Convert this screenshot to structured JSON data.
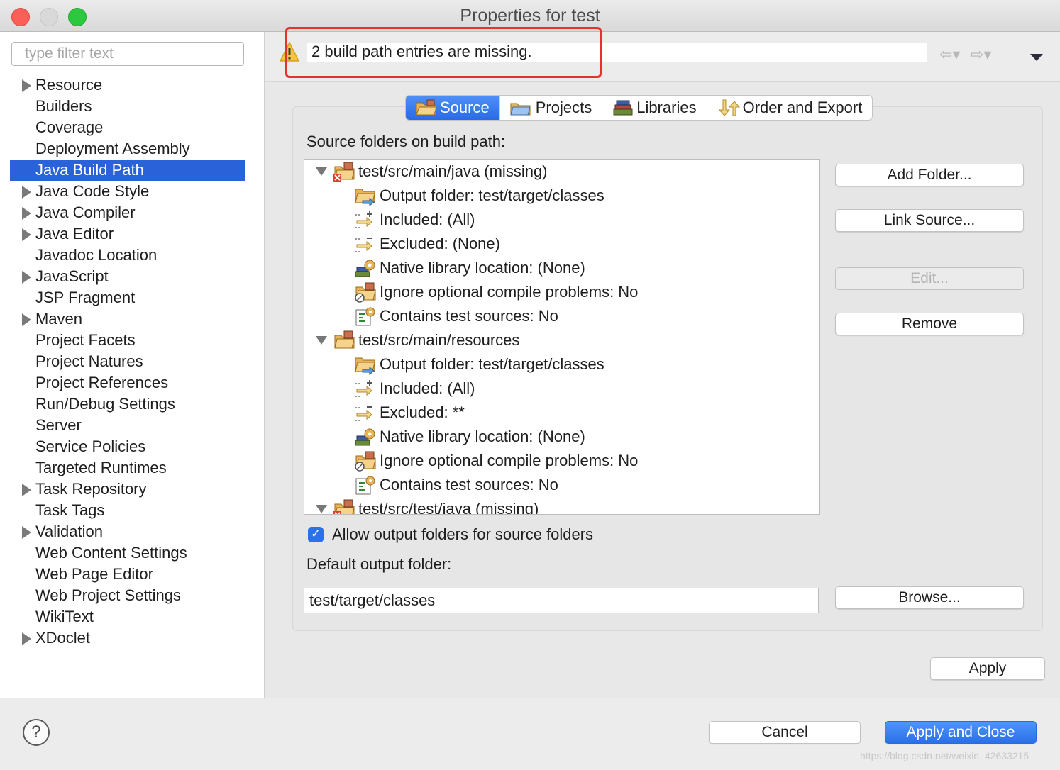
{
  "window": {
    "title": "Properties for test"
  },
  "sidebar": {
    "filter_placeholder": "type filter text",
    "items": [
      {
        "label": "Resource",
        "expandable": true
      },
      {
        "label": "Builders",
        "expandable": false
      },
      {
        "label": "Coverage",
        "expandable": false
      },
      {
        "label": "Deployment Assembly",
        "expandable": false
      },
      {
        "label": "Java Build Path",
        "expandable": false,
        "selected": true
      },
      {
        "label": "Java Code Style",
        "expandable": true
      },
      {
        "label": "Java Compiler",
        "expandable": true
      },
      {
        "label": "Java Editor",
        "expandable": true
      },
      {
        "label": "Javadoc Location",
        "expandable": false
      },
      {
        "label": "JavaScript",
        "expandable": true
      },
      {
        "label": "JSP Fragment",
        "expandable": false
      },
      {
        "label": "Maven",
        "expandable": true
      },
      {
        "label": "Project Facets",
        "expandable": false
      },
      {
        "label": "Project Natures",
        "expandable": false
      },
      {
        "label": "Project References",
        "expandable": false
      },
      {
        "label": "Run/Debug Settings",
        "expandable": false
      },
      {
        "label": "Server",
        "expandable": false
      },
      {
        "label": "Service Policies",
        "expandable": false
      },
      {
        "label": "Targeted Runtimes",
        "expandable": false
      },
      {
        "label": "Task Repository",
        "expandable": true
      },
      {
        "label": "Task Tags",
        "expandable": false
      },
      {
        "label": "Validation",
        "expandable": true
      },
      {
        "label": "Web Content Settings",
        "expandable": false
      },
      {
        "label": "Web Page Editor",
        "expandable": false
      },
      {
        "label": "Web Project Settings",
        "expandable": false
      },
      {
        "label": "WikiText",
        "expandable": false
      },
      {
        "label": "XDoclet",
        "expandable": true
      }
    ]
  },
  "message": {
    "text": "2 build path entries are missing.",
    "icon": "warning-icon"
  },
  "tabs": [
    {
      "label": "Source",
      "active": true,
      "icon": "source-folder-icon"
    },
    {
      "label": "Projects",
      "icon": "projects-icon"
    },
    {
      "label": "Libraries",
      "icon": "libraries-icon"
    },
    {
      "label": "Order and Export",
      "icon": "order-export-icon"
    }
  ],
  "source": {
    "list_label": "Source folders on build path:",
    "entries": [
      {
        "label": "test/src/main/java (missing)",
        "level": 0,
        "icon": "missing-package-folder-icon"
      },
      {
        "label": "Output folder: test/target/classes",
        "level": 1,
        "icon": "output-folder-icon"
      },
      {
        "label": "Included: (All)",
        "level": 1,
        "icon": "included-icon"
      },
      {
        "label": "Excluded: (None)",
        "level": 1,
        "icon": "excluded-icon"
      },
      {
        "label": "Native library location: (None)",
        "level": 1,
        "icon": "native-library-icon"
      },
      {
        "label": "Ignore optional compile problems: No",
        "level": 1,
        "icon": "ignore-problems-icon"
      },
      {
        "label": "Contains test sources: No",
        "level": 1,
        "icon": "test-sources-icon"
      },
      {
        "label": "test/src/main/resources",
        "level": 0,
        "icon": "package-folder-icon"
      },
      {
        "label": "Output folder: test/target/classes",
        "level": 1,
        "icon": "output-folder-icon"
      },
      {
        "label": "Included: (All)",
        "level": 1,
        "icon": "included-icon"
      },
      {
        "label": "Excluded: **",
        "level": 1,
        "icon": "excluded-icon"
      },
      {
        "label": "Native library location: (None)",
        "level": 1,
        "icon": "native-library-icon"
      },
      {
        "label": "Ignore optional compile problems: No",
        "level": 1,
        "icon": "ignore-problems-icon"
      },
      {
        "label": "Contains test sources: No",
        "level": 1,
        "icon": "test-sources-icon"
      },
      {
        "label": "test/src/test/java (missing)",
        "level": 0,
        "icon": "missing-package-folder-icon"
      }
    ],
    "buttons": {
      "add_folder": "Add Folder...",
      "link_source": "Link Source...",
      "edit": "Edit...",
      "remove": "Remove",
      "browse": "Browse..."
    },
    "allow_output_label": "Allow output folders for source folders",
    "allow_output_checked": true,
    "default_output_label": "Default output folder:",
    "default_output_value": "test/target/classes"
  },
  "footer": {
    "apply": "Apply",
    "cancel": "Cancel",
    "apply_close": "Apply and Close",
    "help_glyph": "?"
  },
  "watermark": "https://blog.csdn.net/weixin_42633215",
  "colors": {
    "selection": "#2a62d9",
    "primary": "#2a6fe8",
    "highlight": "#e3332b"
  }
}
